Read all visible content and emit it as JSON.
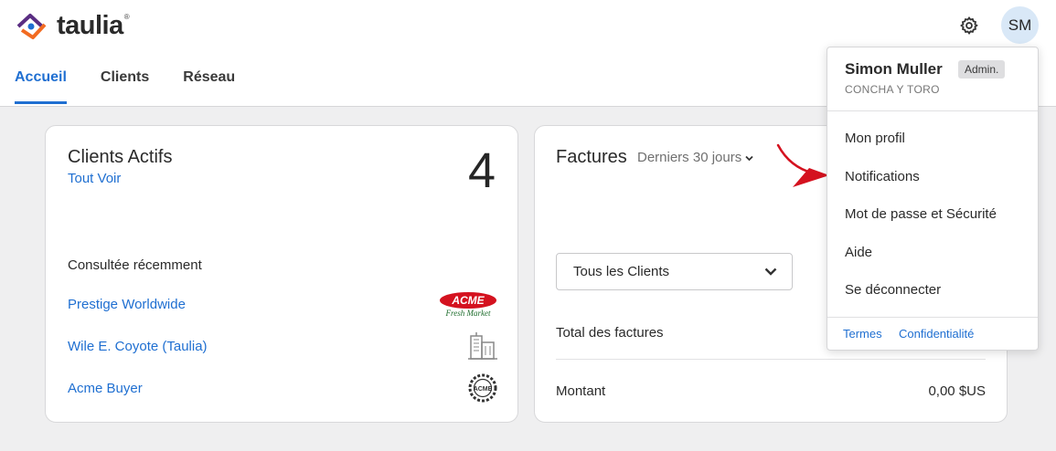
{
  "brand": {
    "name": "taulia",
    "reg": "®"
  },
  "nav": {
    "tabs": [
      {
        "label": "Accueil"
      },
      {
        "label": "Clients"
      },
      {
        "label": "Réseau"
      }
    ]
  },
  "header": {
    "avatar_initials": "SM"
  },
  "clients_card": {
    "title": "Clients Actifs",
    "view_all": "Tout Voir",
    "count": "4",
    "recent_heading": "Consultée récemment",
    "recent": [
      {
        "name": "Prestige Worldwide",
        "logo_text": "ACME",
        "logo_sub": "Fresh Market"
      },
      {
        "name": "Wile E. Coyote (Taulia)",
        "icon": "building-icon"
      },
      {
        "name": "Acme Buyer",
        "logo_text": "ACME"
      }
    ]
  },
  "invoices_card": {
    "title": "Factures",
    "period": "Derniers 30 jours",
    "client_select": "Tous les Clients",
    "total_label": "Total des factures",
    "amount_label": "Montant",
    "amount_value": "0,00 $US"
  },
  "user_menu": {
    "name": "Simon Muller",
    "role": "Admin.",
    "company": "CONCHA Y TORO",
    "items": [
      {
        "label": "Mon profil"
      },
      {
        "label": "Notifications"
      },
      {
        "label": "Mot de passe et Sécurité"
      },
      {
        "label": "Aide"
      },
      {
        "label": "Se déconnecter"
      }
    ],
    "footer": {
      "terms": "Termes",
      "privacy": "Confidentialité"
    }
  },
  "colors": {
    "accent": "#1f6fd1",
    "logo_orange": "#f26b21",
    "logo_purple": "#5a2d82",
    "annotation_red": "#d4121f"
  }
}
